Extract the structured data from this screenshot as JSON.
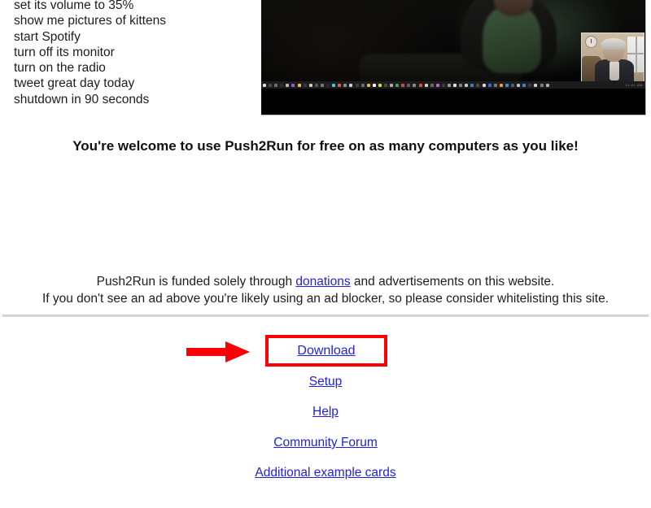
{
  "page": {
    "background_color": "#ffffff",
    "link_color": "#2222dd",
    "highlight_color": "#fb0007",
    "divider_color": "#d9d9d9"
  },
  "examples": {
    "commands": [
      "set its volume to 35%",
      "show me pictures of kittens",
      "start Spotify",
      "turn off its monitor",
      "turn on the radio",
      "tweet great day today",
      "shutdown in 90 seconds"
    ]
  },
  "video": {
    "name": "push2run-demo-video",
    "description": "Dark screen recording with webcam inset of a presenter",
    "webcam_inset_name": "webcam-inset",
    "taskbar_name": "windows-taskbar",
    "tray_text": "11:41 AM",
    "taskbar_icon_colors": [
      "#dcdcdc",
      "#4a4a4a",
      "#6f6f6f",
      "#2f2f2f",
      "#b8b8b8",
      "#9b59d0",
      "#e8c23a",
      "#3a3a3a",
      "#c9c9c9",
      "#555555",
      "#7a7a7a",
      "#2a2a2a",
      "#4fc3c7",
      "#e05b5b",
      "#8c8c8c",
      "#d0d0d0",
      "#3f3f3f",
      "#6b6b6b",
      "#e8b43a",
      "#efefef",
      "#d6d63a",
      "#4a4a4a",
      "#aeaeae",
      "#3aa05a",
      "#c94f4f",
      "#5f5f5f",
      "#8a8a8a",
      "#e84a4a",
      "#cfcfcf",
      "#6a6a6a",
      "#b36ad6",
      "#3a3a3a",
      "#9a9a9a",
      "#e0e0e0",
      "#7f7f7f",
      "#c7c7c7",
      "#3f7fd0",
      "#4a4a4a",
      "#d6d6d6",
      "#2f6fd0",
      "#7a7a7a",
      "#e8a03a",
      "#3f8fd0",
      "#5a5a5a",
      "#bdbdbd",
      "#4a7fd0",
      "#3a3a3a",
      "#cccccc",
      "#7d7d7d",
      "#b0b0b0"
    ]
  },
  "headline": {
    "text": "You're welcome to use Push2Run for free on as many computers as you like!"
  },
  "funding": {
    "line1_before": "Push2Run is funded solely through ",
    "line1_link": "donations",
    "line1_after": " and advertisements on this website.",
    "line2": "If you don't see an ad above you're likely using an ad blocker, so please consider whitelisting this site."
  },
  "annotation": {
    "arrow_name": "red-arrow-pointing-to-download",
    "arrow_color": "#fb0007",
    "highlight_box_color": "#fb0007"
  },
  "links": [
    {
      "label": "Download",
      "name": "download-link"
    },
    {
      "label": "Setup",
      "name": "setup-link"
    },
    {
      "label": "Help",
      "name": "help-link"
    },
    {
      "label": "Community Forum",
      "name": "community-forum-link"
    },
    {
      "label": "Additional example cards",
      "name": "additional-example-cards-link"
    }
  ]
}
